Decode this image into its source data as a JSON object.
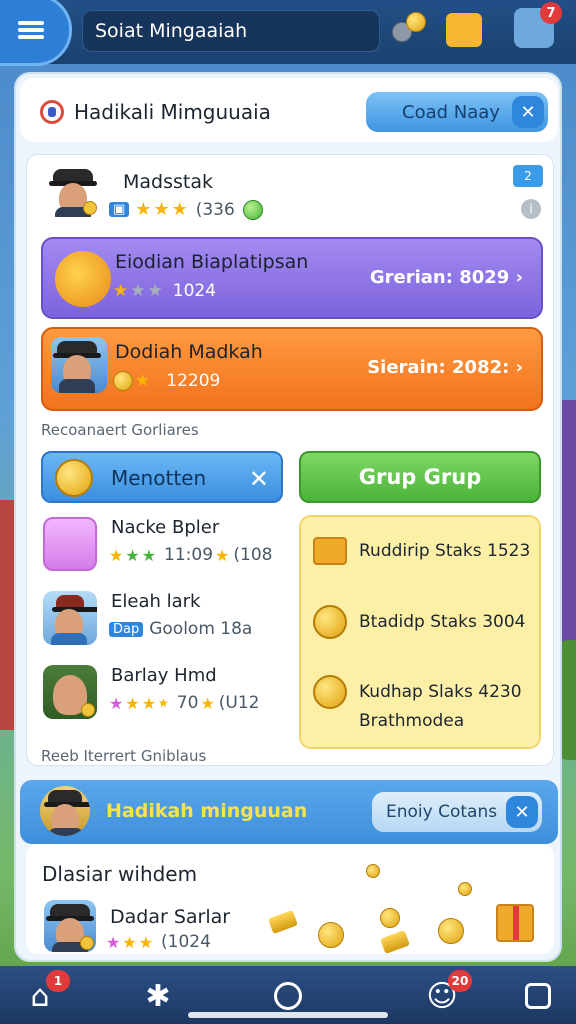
{
  "topbar": {
    "search_text": "Soiat Mingaaiah",
    "profile_badge": "7"
  },
  "header": {
    "title": "Hadikali Mimguuaia",
    "button_label": "Coad Naay",
    "close_glyph": "✕"
  },
  "player": {
    "name": "Madsstak",
    "stat": "(336",
    "badge": "2"
  },
  "banners": [
    {
      "name": "Eiodian Biaplatipsan",
      "stat": "1024",
      "right": "Grerian: 8029 ›"
    },
    {
      "name": "Dodiah Madkah",
      "stat": "12209",
      "right": "Sierain: 2082: ›"
    }
  ],
  "section1_label": "Recoanaert Gorliares",
  "tabs": {
    "blue_label": "Menotten",
    "green_label": "Grup Grup"
  },
  "list": [
    {
      "name": "Nacke Bpler",
      "stat": "11:09",
      "stat2": "(108"
    },
    {
      "name": "Eleah lark",
      "tag": "Dap",
      "stat": "Goolom 18a"
    },
    {
      "name": "Barlay Hmd",
      "stat": "70",
      "stat2": "(U12"
    }
  ],
  "yellow_box": {
    "items": [
      "Ruddirip Staks 1523",
      "Btadidp Staks 3004",
      "Kudhap Slaks 4230"
    ],
    "sub": "Brathmodea"
  },
  "section2_label": "Reeb Iterrert Gniblaus",
  "footer": {
    "title": "Hadikah minguuan",
    "button_label": "Enoiy Cotans"
  },
  "bottom": {
    "title": "Dlasiar wihdem",
    "name": "Dadar Sarlar",
    "stat": "(1024"
  },
  "navbar": {
    "home_badge": "1",
    "chat_badge": "20"
  },
  "colors": {
    "accent_blue": "#3f95e0",
    "purple_banner": "#7d63dc",
    "orange_banner": "#f2731e",
    "green_tab": "#4bb33a",
    "badge_red": "#e23a3a"
  }
}
